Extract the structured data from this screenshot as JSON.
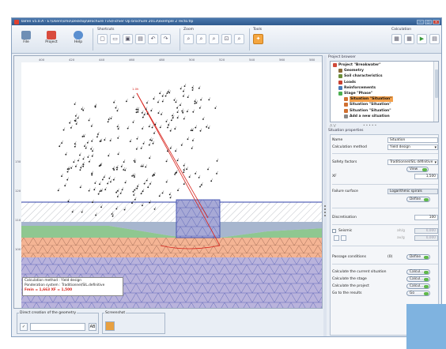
{
  "window": {
    "title": "Talren v5.0.A - E:\\Users\\smo\\Desktop\\Brochure TvS\\Fichier Op brochure 2013\\exemple 2 recto.tlp",
    "controls": [
      "–",
      "□",
      "×"
    ]
  },
  "ribbon": {
    "file": "File",
    "project": "Project",
    "help": "Help",
    "shortcuts": "Shortcuts",
    "zoom": "Zoom",
    "tools": "Tools",
    "calculation": "Calculation"
  },
  "canvas": {
    "rulers": [
      "400",
      "420",
      "440",
      "460",
      "480",
      "500",
      "520",
      "540",
      "560",
      "580"
    ],
    "left_rulers": [
      "130",
      "120",
      "110",
      "100"
    ],
    "lambda_label": "1.0h",
    "info": {
      "method": "Calculation method : Yield design",
      "system": "Ponderation system : Traditionnel/SIL.definitive",
      "result": "Fmin = 1,663   XF = 1,500"
    }
  },
  "bottom": {
    "direct_creation": "Direct creation of the geometry",
    "screenshot": "Screenshot"
  },
  "project_browser": {
    "title": "Project browser",
    "items": [
      {
        "label": "Project \"Breakwater\"",
        "indent": 0,
        "icon": "#d04a3a"
      },
      {
        "label": "Geometry",
        "indent": 1,
        "icon": "#8b6b3a"
      },
      {
        "label": "Soil characteristics",
        "indent": 1,
        "icon": "#6b8e3a"
      },
      {
        "label": "Loads",
        "indent": 1,
        "icon": "#c84030"
      },
      {
        "label": "Reinforcements",
        "indent": 1,
        "icon": "#4a7ab8"
      },
      {
        "label": "Stage \"Phase\"",
        "indent": 1,
        "icon": "#4caf50"
      },
      {
        "label": "Situation \"Situation\"",
        "indent": 2,
        "icon": "#d07030",
        "selected": true
      },
      {
        "label": "Situation \"Situation\"",
        "indent": 2,
        "icon": "#d07030"
      },
      {
        "label": "Situation \"Situation\"",
        "indent": 2,
        "icon": "#d07030"
      },
      {
        "label": "Add a new situation",
        "indent": 2,
        "icon": "#888888"
      }
    ]
  },
  "situation_properties": {
    "title": "Situation properties",
    "name_label": "Name",
    "name_value": "Situation",
    "method_label": "Calculation method",
    "method_value": "Yield design",
    "safety_label": "Safety factors",
    "safety_value": "Traditionnel/SIL définitive",
    "view_button": "View",
    "xf_label": "XF",
    "xf_value": "1,500",
    "failure_label": "Failure surface",
    "failure_value": "Logarithmic spirals",
    "define_button": "Define",
    "discretisation_label": "Discretisation",
    "discretisation_value": "100",
    "seismic_label": "Seismic",
    "ah_label": "ah/g",
    "ah_value": "0,000",
    "av_label": "av/g",
    "av_value": "0,000",
    "passage_label": "Passage conditions",
    "passage_count": "(0)",
    "passage_button": "Define",
    "calc_current_label": "Calculate the current situation",
    "calc_stage_label": "Calculate the stage",
    "calc_project_label": "Calculate the project",
    "go_results_label": "Go to the results",
    "calc_button": "Calcul...",
    "go_button": "Go"
  }
}
